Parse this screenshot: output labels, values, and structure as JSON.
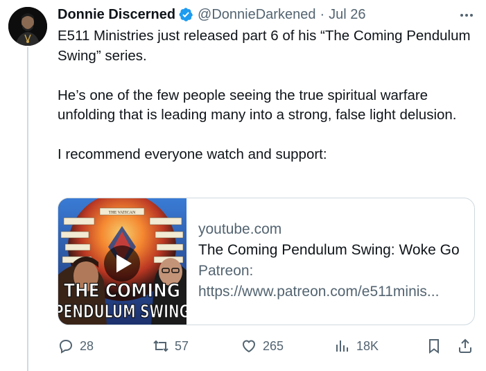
{
  "author": {
    "name": "Donnie Discerned",
    "handle": "@DonnieDarkened",
    "separator": "·",
    "date": "Jul 26",
    "verified": true
  },
  "post": {
    "paragraphs": [
      "E511 Ministries just released part 6 of his “The Coming Pendulum Swing” series.",
      "He’s one of the few people seeing the true spiritual warfare unfolding that is leading many into a strong, false light delusion.",
      "I recommend everyone watch and support:"
    ]
  },
  "card": {
    "domain": "youtube.com",
    "title": "The Coming Pendulum Swing: Woke Go",
    "desc_line1": "Patreon:",
    "desc_line2": "https://www.patreon.com/e511minis...",
    "thumb_text_line1": "THE COMING",
    "thumb_text_line2": "PENDULUM SWING",
    "thumb_header": "THE VATICAN"
  },
  "actions": {
    "replies": "28",
    "reposts": "57",
    "likes": "265",
    "views": "18K"
  },
  "colors": {
    "text_primary": "#0f1419",
    "text_secondary": "#536471",
    "verified": "#1d9bf0",
    "border": "#cfd9de"
  },
  "icons": [
    "verified-icon",
    "more-icon",
    "reply-icon",
    "repost-icon",
    "like-icon",
    "views-icon",
    "bookmark-icon",
    "share-icon",
    "play-icon"
  ]
}
